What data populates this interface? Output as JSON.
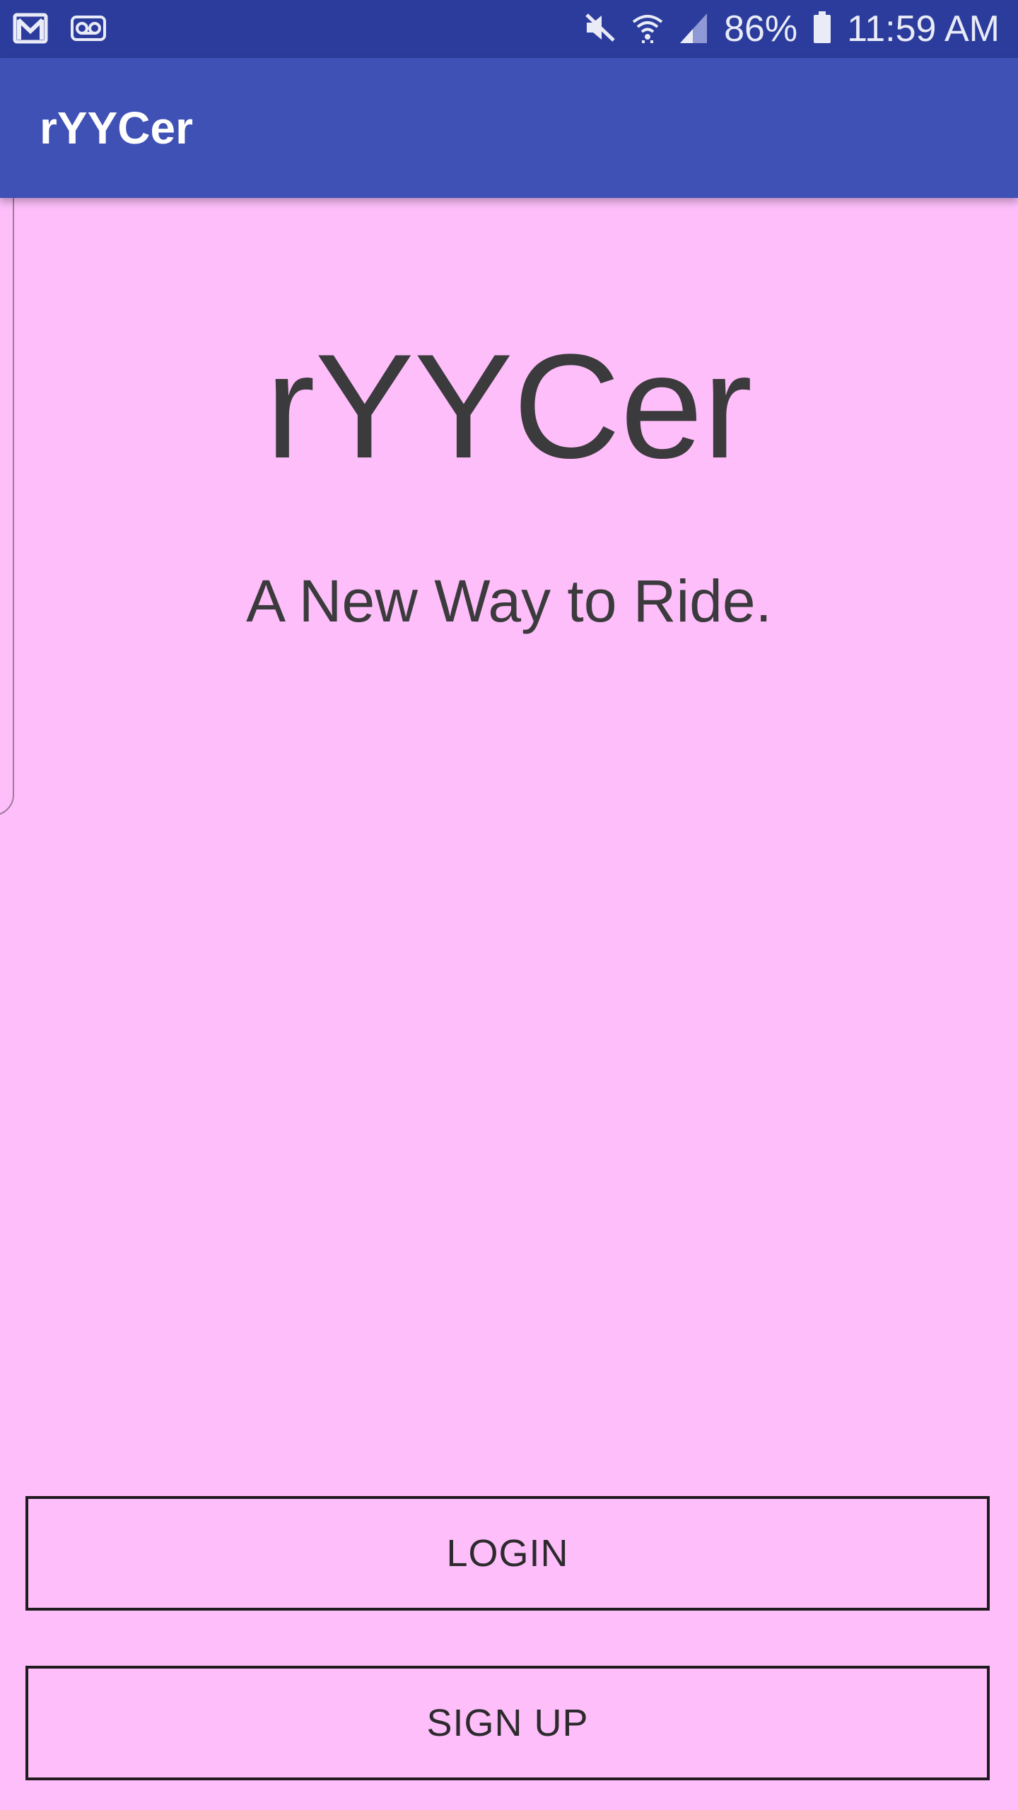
{
  "status_bar": {
    "battery": "86%",
    "time": "11:59 AM",
    "left_icons": [
      "gmail-icon",
      "voicemail-icon"
    ],
    "right_icons": [
      "mute-icon",
      "wifi-icon",
      "signal-icon",
      "battery-icon"
    ]
  },
  "app_bar": {
    "title": "rYYCer"
  },
  "hero": {
    "title": "rYYCer",
    "subtitle": "A New Way to Ride."
  },
  "buttons": {
    "login": "LOGIN",
    "signup": "SIGN UP"
  },
  "colors": {
    "status_bar": "#2c3c9c",
    "app_bar": "#3f51b5",
    "background": "#fdbefa",
    "text": "#3b3a3c"
  }
}
